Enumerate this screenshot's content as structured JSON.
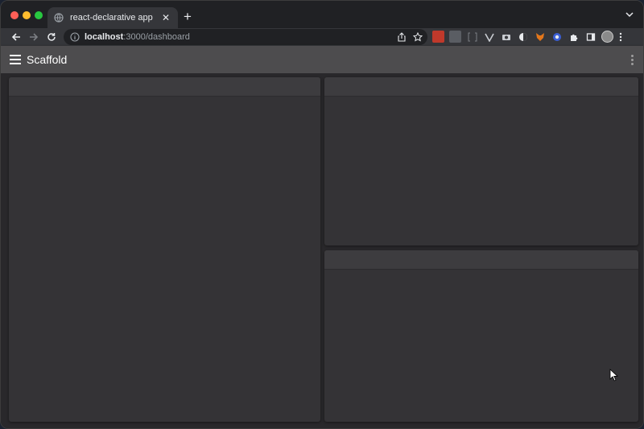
{
  "browser": {
    "tab": {
      "title": "react-declarative app",
      "close_label": "✕"
    },
    "new_tab_label": "+",
    "url": {
      "host": "localhost",
      "path": ":3000/dashboard"
    }
  },
  "app": {
    "title": "Scaffold"
  },
  "dashboard": {
    "cards": [
      {
        "id": "left"
      },
      {
        "id": "top-right"
      },
      {
        "id": "bottom-right"
      }
    ]
  },
  "colors": {
    "appbar": "#4d4c4e",
    "content_bg": "#29282b",
    "card_bg": "#343336",
    "card_header": "#3d3c3f"
  }
}
